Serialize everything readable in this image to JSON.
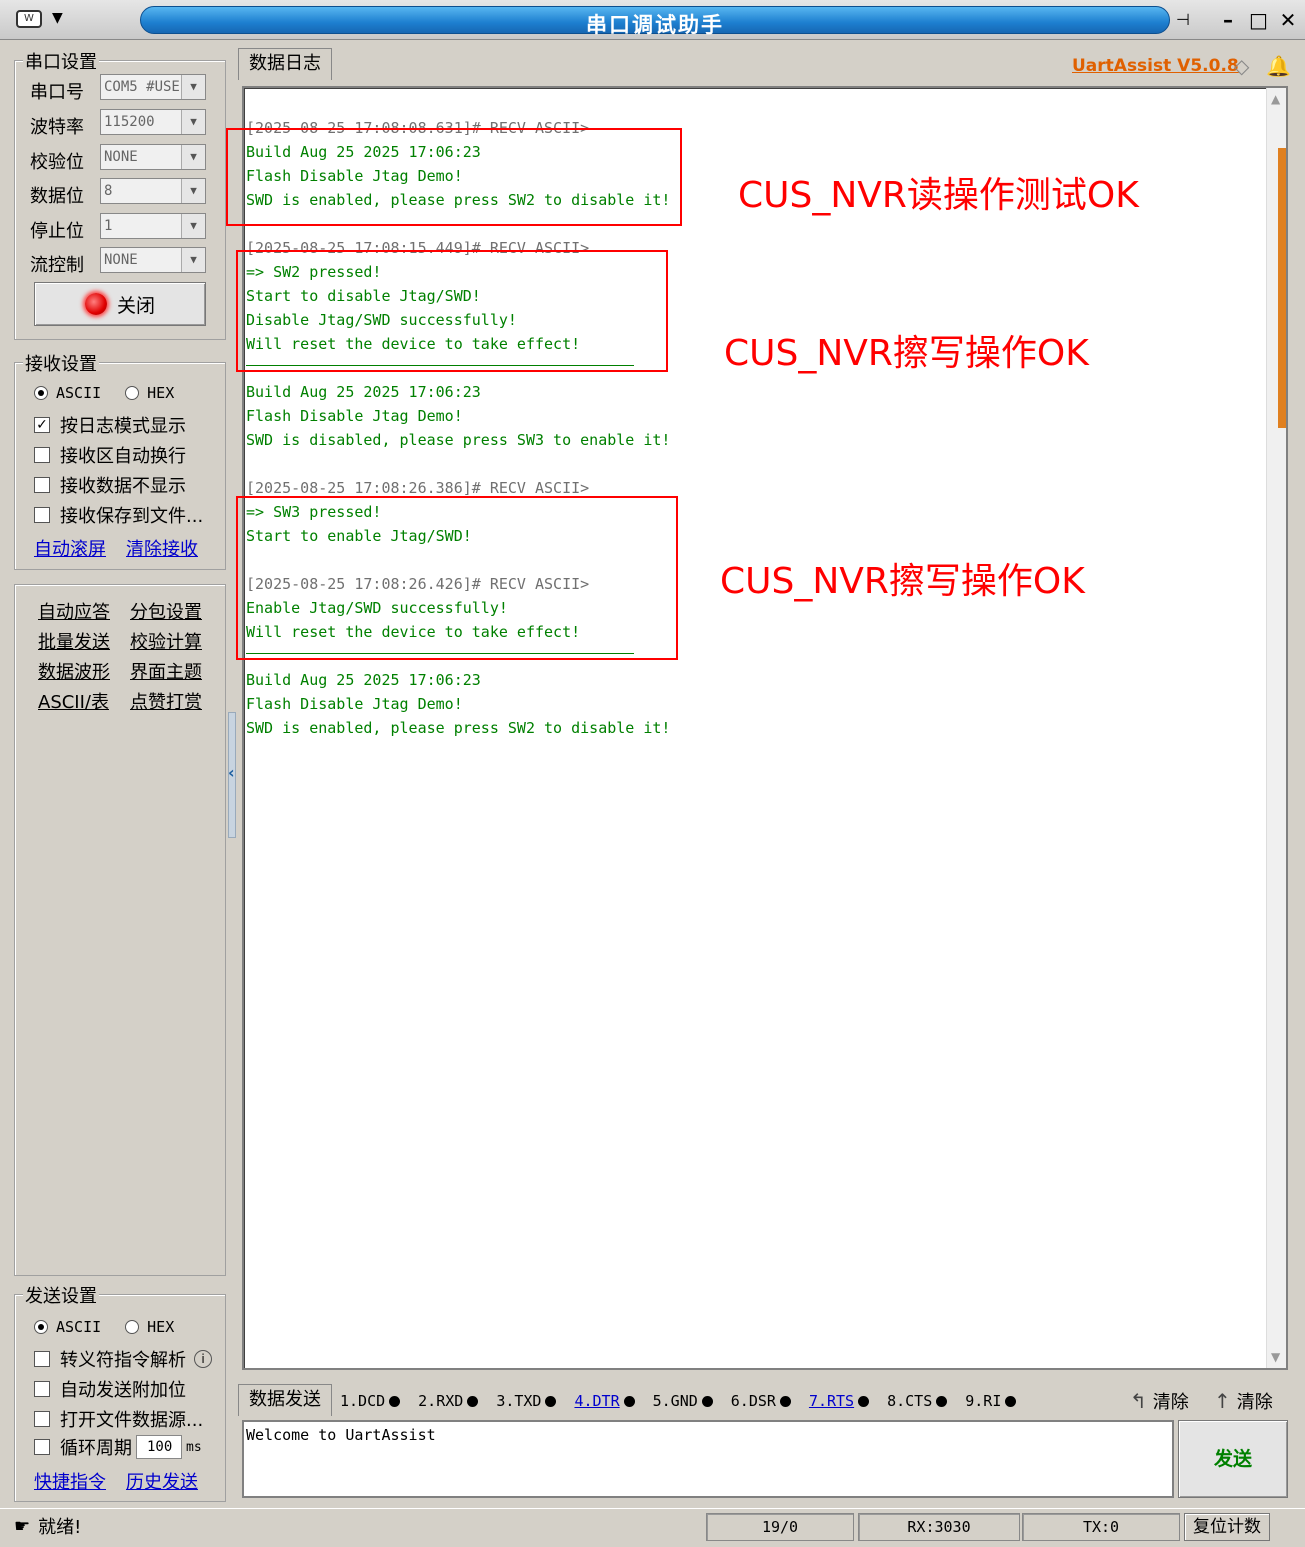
{
  "window": {
    "title": "串口调试助手",
    "app_icon": "app-icon",
    "minimize": "–",
    "maximize": "□",
    "close": "✕",
    "pin": "📌"
  },
  "serial": {
    "group_title": "串口设置",
    "port_label": "串口号",
    "port_value": "COM5 #USE",
    "baud_label": "波特率",
    "baud_value": "115200",
    "parity_label": "校验位",
    "parity_value": "NONE",
    "databits_label": "数据位",
    "databits_value": "8",
    "stopbits_label": "停止位",
    "stopbits_value": "1",
    "flow_label": "流控制",
    "flow_value": "NONE",
    "open_button": "关闭"
  },
  "receive": {
    "group_title": "接收设置",
    "ascii": "ASCII",
    "hex": "HEX",
    "mode": "ASCII",
    "opt_log": "按日志模式显示",
    "opt_log_checked": true,
    "opt_wrap": "接收区自动换行",
    "opt_hide": "接收数据不显示",
    "opt_save": "接收保存到文件...",
    "link_autoscroll": "自动滚屏",
    "link_clear": "清除接收"
  },
  "tools": {
    "items": [
      "自动应答",
      "分包设置",
      "批量发送",
      "校验计算",
      "数据波形",
      "界面主题",
      "ASCII/表",
      "点赞打赏"
    ]
  },
  "send_settings": {
    "group_title": "发送设置",
    "ascii": "ASCII",
    "hex": "HEX",
    "mode": "ASCII",
    "opt_escape": "转义符指令解析",
    "opt_checksum": "自动发送附加位",
    "opt_file": "打开文件数据源...",
    "opt_cycle": "循环周期",
    "cycle_value": "100",
    "cycle_unit": "ms",
    "link_shortcut": "快捷指令",
    "link_history": "历史发送"
  },
  "log": {
    "tab": "数据日志",
    "version": "UartAssist V5.0.8",
    "lines": [
      {
        "t": "hdr",
        "s": "[2025-08-25 17:08:08.631]# RECV ASCII>"
      },
      {
        "t": "dat",
        "s": "Build Aug 25 2025 17:06:23"
      },
      {
        "t": "dat",
        "s": "Flash Disable Jtag Demo!"
      },
      {
        "t": "dat",
        "s": "SWD is enabled, please press SW2 to disable it!"
      },
      {
        "t": "blank",
        "s": ""
      },
      {
        "t": "hdr",
        "s": "[2025-08-25 17:08:15.449]# RECV ASCII>"
      },
      {
        "t": "dat",
        "s": "=> SW2 pressed!"
      },
      {
        "t": "dat",
        "s": "Start to disable Jtag/SWD!"
      },
      {
        "t": "dat",
        "s": "Disable Jtag/SWD successfully!"
      },
      {
        "t": "dat",
        "s": "Will reset the device to take effect!"
      },
      {
        "t": "blank",
        "s": ""
      },
      {
        "t": "dat",
        "s": "Build Aug 25 2025 17:06:23"
      },
      {
        "t": "dat",
        "s": "Flash Disable Jtag Demo!"
      },
      {
        "t": "dat",
        "s": "SWD is disabled, please press SW3 to enable it!"
      },
      {
        "t": "blank",
        "s": ""
      },
      {
        "t": "hdr",
        "s": "[2025-08-25 17:08:26.386]# RECV ASCII>"
      },
      {
        "t": "dat",
        "s": "=> SW3 pressed!"
      },
      {
        "t": "dat",
        "s": "Start to enable Jtag/SWD!"
      },
      {
        "t": "blank",
        "s": ""
      },
      {
        "t": "hdr",
        "s": "[2025-08-25 17:08:26.426]# RECV ASCII>"
      },
      {
        "t": "dat",
        "s": "Enable Jtag/SWD successfully!"
      },
      {
        "t": "dat",
        "s": "Will reset the device to take effect!"
      },
      {
        "t": "blank",
        "s": ""
      },
      {
        "t": "dat",
        "s": "Build Aug 25 2025 17:06:23"
      },
      {
        "t": "dat",
        "s": "Flash Disable Jtag Demo!"
      },
      {
        "t": "dat",
        "s": "SWD is enabled, please press SW2 to disable it!"
      }
    ]
  },
  "annotations": {
    "a1": "CUS_NVR读操作测试OK",
    "a2": "CUS_NVR擦写操作OK",
    "a3": "CUS_NVR擦写操作OK",
    "color": "#ff0000"
  },
  "send": {
    "tab": "数据发送",
    "pins": [
      {
        "label": "1.DCD",
        "link": false
      },
      {
        "label": "2.RXD",
        "link": false
      },
      {
        "label": "3.TXD",
        "link": false
      },
      {
        "label": "4.DTR",
        "link": true
      },
      {
        "label": "5.GND",
        "link": false
      },
      {
        "label": "6.DSR",
        "link": false
      },
      {
        "label": "7.RTS",
        "link": true
      },
      {
        "label": "8.CTS",
        "link": false
      },
      {
        "label": "9.RI",
        "link": false
      }
    ],
    "clear1": "清除",
    "clear2": "清除",
    "text": "Welcome to UartAssist",
    "send_button": "发送"
  },
  "status": {
    "ready": "就绪!",
    "count": "19/0",
    "rx": "RX:3030",
    "tx": "TX:0",
    "reset": "复位计数"
  }
}
